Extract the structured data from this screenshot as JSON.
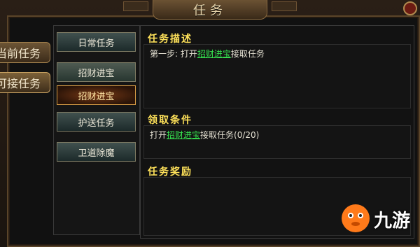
{
  "window": {
    "title": "任务"
  },
  "side_tabs": [
    {
      "label": "当前任务"
    },
    {
      "label": "可接任务"
    }
  ],
  "quest_list": {
    "items": [
      {
        "label": "日常任务"
      },
      {
        "label": "招财进宝"
      },
      {
        "label": "招财进宝"
      },
      {
        "label": "护送任务"
      },
      {
        "label": "卫道除魔"
      }
    ],
    "selected_index": 2
  },
  "detail": {
    "description": {
      "heading": "任务描述",
      "prefix": "第一步: 打开",
      "link": "招财进宝",
      "suffix": "接取任务"
    },
    "requirements": {
      "heading": "领取条件",
      "prefix": "打开",
      "link": "招财进宝",
      "suffix": "接取任务(0/20)"
    },
    "rewards": {
      "heading": "任务奖励"
    }
  },
  "watermark": {
    "text": "九游"
  },
  "colors": {
    "heading": "#ffe25a",
    "link": "#36e24f",
    "frame": "#5a4429",
    "selected": "#d69c45"
  }
}
